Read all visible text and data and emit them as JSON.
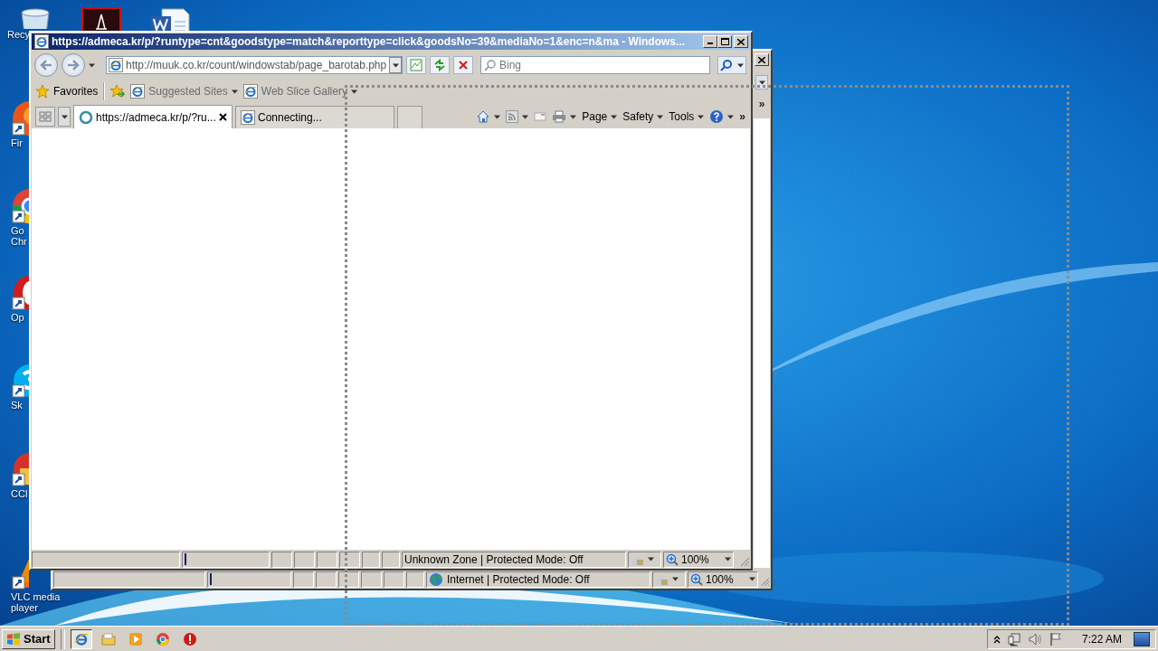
{
  "desktop": {
    "icons": [
      {
        "kind": "recycle-bin",
        "label_lines": [
          "Recy"
        ]
      },
      {
        "kind": "pdf"
      },
      {
        "kind": "word"
      },
      {
        "kind": "firefox",
        "label_lines": [
          "Fir"
        ]
      },
      {
        "kind": "chrome",
        "label_lines": [
          "Go",
          "Chr"
        ]
      },
      {
        "kind": "opera",
        "label_lines": [
          "Op"
        ]
      },
      {
        "kind": "skype",
        "label_lines": [
          "Sk"
        ]
      },
      {
        "kind": "ccleaner",
        "label_lines": [
          "CCl"
        ]
      },
      {
        "kind": "vlc",
        "label_lines": [
          "VLC media",
          "player"
        ]
      }
    ]
  },
  "back_window": {
    "chevron": "»",
    "status_bar": {
      "zone": "Internet | Protected Mode: Off",
      "zoom": "100%"
    }
  },
  "front_window": {
    "title": "https://admeca.kr/p/?runtype=cnt&goodstype=match&reporttype=click&goodsNo=39&mediaNo=1&enc=n&ma - Windows...",
    "address": "http://muuk.co.kr/count/windowstab/page_barotab.php",
    "search": {
      "placeholder": "Bing"
    },
    "favorites_bar": {
      "favorites": "Favorites",
      "links": [
        "Suggested Sites",
        "Web Slice Gallery"
      ]
    },
    "tabs": [
      {
        "kind": "loading",
        "label": "https://admeca.kr/p/?ru...",
        "selected": true
      },
      {
        "kind": "page",
        "label": "Connecting...",
        "selected": false
      }
    ],
    "command_bar": {
      "menus": [
        "Page",
        "Safety",
        "Tools"
      ],
      "chevron": "»"
    },
    "status_bar": {
      "zone": "Unknown Zone | Protected Mode: Off",
      "zoom": "100%"
    }
  },
  "taskbar": {
    "start": "Start",
    "clock": "7:22 AM"
  }
}
